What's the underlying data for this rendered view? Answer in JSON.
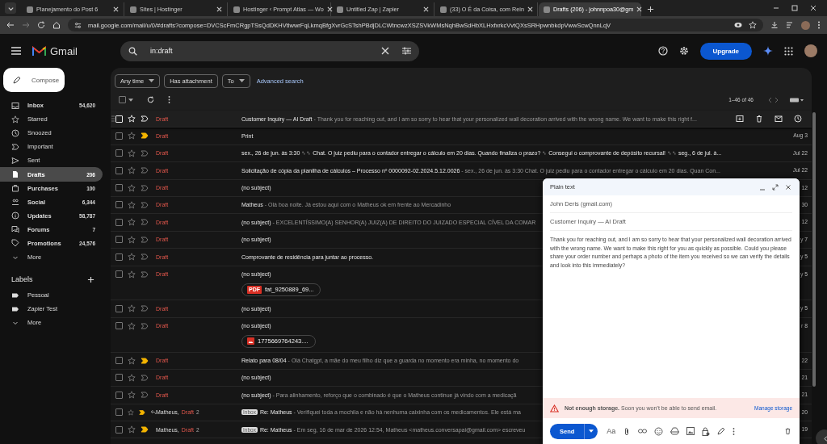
{
  "browser": {
    "tabs": [
      {
        "title": "Planejamento do Post 6",
        "selected": false
      },
      {
        "title": "Sites | Hostinger",
        "selected": false
      },
      {
        "title": "Hostinger ‹ Prompt Atlas — Wo",
        "selected": false
      },
      {
        "title": "Untitled Zap | Zapier",
        "selected": false
      },
      {
        "title": "(33) O É da Coisa, com Rein",
        "selected": false
      },
      {
        "title": "Drafts (206) - johnnpoa30@gm",
        "selected": true
      }
    ],
    "url": "mail.google.com/mail/u/0/#drafts?compose=DVCScFmCRgpTSsQdDKHVtlwwrFqLkmqBfgXvrGcSTshPBdjDLCWtncwzXSZSVkWMsNqhBwSdHbXLHxfxrkcVvtQXsSRHpwnbkdpVwwScwQnnLqV"
  },
  "app": {
    "logo": "Gmail",
    "search": "in:draft",
    "upgrade": "Upgrade"
  },
  "sidebar": {
    "compose": "Compose",
    "items": [
      {
        "label": "Inbox",
        "count": "54,620",
        "bold": true,
        "selected": false
      },
      {
        "label": "Starred",
        "bold": false,
        "selected": false
      },
      {
        "label": "Snoozed",
        "bold": false,
        "selected": false
      },
      {
        "label": "Important",
        "bold": false,
        "selected": false
      },
      {
        "label": "Sent",
        "bold": false,
        "selected": false
      },
      {
        "label": "Drafts",
        "count": "206",
        "bold": true,
        "selected": true
      },
      {
        "label": "Purchases",
        "count": "100",
        "bold": true,
        "selected": false
      },
      {
        "label": "Social",
        "count": "6,344",
        "bold": true,
        "selected": false
      },
      {
        "label": "Updates",
        "count": "58,787",
        "bold": true,
        "selected": false
      },
      {
        "label": "Forums",
        "count": "7",
        "bold": true,
        "selected": false
      },
      {
        "label": "Promotions",
        "count": "24,576",
        "bold": true,
        "selected": false
      },
      {
        "label": "More",
        "kind": "more",
        "bold": false,
        "selected": false
      }
    ],
    "labels_title": "Labels",
    "labels": [
      {
        "label": "Pessoal",
        "kind": "label"
      },
      {
        "label": "Zapier Test",
        "kind": "label"
      },
      {
        "label": "More",
        "kind": "more"
      }
    ]
  },
  "select_all": {
    "checked": false
  },
  "filters": [
    "Any time",
    "Has attachment",
    "To"
  ],
  "advanced_search": "Advanced search",
  "pagination": "1–46 of 46",
  "rows": [
    {
      "draft": "Draft",
      "subject": "Customer Inquiry — AI Draft",
      "preview": " - Thank you for reaching out, and I am so sorry to hear that your personalized wall decoration arrived with the wrong name. We want to make this right f...",
      "important": false,
      "hovered": true,
      "checked": false,
      "starred": false
    },
    {
      "draft": "Draft",
      "subject": "Print",
      "important": true,
      "hovered": false,
      "checked": false,
      "starred": false,
      "date": "Aug 3"
    },
    {
      "draft": "Draft",
      "subject": "sex., 26 de jun. às 3:30 ␞␞ Chat. O juiz pediu para o contador entregar o cálculo em 20 dias. Quando finaliza o prazo? ␞ Consegui o comprovante de depósito recursal! ␞␞ seg., 6 de jul. à...",
      "important": false,
      "hovered": false,
      "checked": false,
      "starred": false,
      "date": "Jul 22"
    },
    {
      "draft": "Draft",
      "subject": "Solicitação de cópia da planilha de cálculos – Processo nº 0000092-02.2024.5.12.0026",
      "preview": " - sex., 26 de jun. às 3:30 Chat. O juiz pediu para o contador entregar o cálculo em 20 dias. Quan Con...",
      "important": false,
      "hovered": false,
      "checked": false,
      "starred": false,
      "date": "Jul 22"
    },
    {
      "draft": "Draft",
      "subject": "(no subject)",
      "important": false,
      "hovered": false,
      "checked": false,
      "starred": false,
      "date": "12"
    },
    {
      "draft": "Draft",
      "subject": "Matheus",
      "preview": " - Olá boa noite. Já estou aqui com o Matheus ok em frente ao Mercadinho",
      "important": false,
      "hovered": false,
      "checked": false,
      "starred": false,
      "date": "30"
    },
    {
      "draft": "Draft",
      "subject": "(no subject)",
      "preview": " - EXCELENTÍSSIMO(A) SENHOR(A) JUIZ(A) DE DIREITO DO JUIZADO ESPECIAL CÍVEL DA COMAR",
      "important": false,
      "hovered": false,
      "checked": false,
      "starred": false,
      "date": "12"
    },
    {
      "draft": "Draft",
      "subject": "(no subject)",
      "important": false,
      "hovered": false,
      "checked": false,
      "starred": false,
      "date": "y 7"
    },
    {
      "draft": "Draft",
      "subject": "Comprovante de residência para juntar ao processo.",
      "important": false,
      "hovered": false,
      "checked": false,
      "starred": false,
      "date": "y 5"
    },
    {
      "draft": "Draft",
      "subject": "(no subject)",
      "attachment": {
        "name": "fat_9250889_69...",
        "kind": "pdf",
        "badge": "PDF"
      },
      "important": false,
      "hovered": false,
      "checked": false,
      "starred": false,
      "date": "y 5"
    },
    {
      "draft": "Draft",
      "subject": "(no subject)",
      "important": false,
      "hovered": false,
      "checked": false,
      "starred": false,
      "date": "y 5"
    },
    {
      "draft": "Draft",
      "subject": "(no subject)",
      "attachment": {
        "name": "1775669764243....",
        "kind": "image"
      },
      "important": false,
      "hovered": false,
      "checked": false,
      "starred": false,
      "date": "r 8"
    },
    {
      "draft": "Draft",
      "subject": "Relato para 08/04",
      "preview": " - Olá Chatgpt, a mãe do meu filho diz que a guarda no momento era minha, no momento do",
      "important": true,
      "hovered": false,
      "checked": false,
      "starred": false,
      "date": "22"
    },
    {
      "draft": "Draft",
      "subject": "(no subject)",
      "important": false,
      "hovered": false,
      "checked": false,
      "starred": false,
      "date": "21"
    },
    {
      "draft": "Draft",
      "subject": "(no subject)",
      "preview": " - Para alinhamento, reforço que o combinado é que o Matheus continue já vindo com a medicaçã",
      "important": false,
      "hovered": false,
      "checked": false,
      "starred": false,
      "date": "21"
    },
    {
      "name": "Matheus,",
      "draft": "Draft",
      "count": "2",
      "replied": true,
      "tag": "Inbox",
      "subject": "Re: Matheus",
      "preview": " - Verifiquei toda a mochila e não há nenhuma caixinha com os medicamentos. Ele está ma",
      "important": true,
      "hovered": false,
      "checked": false,
      "starred": false,
      "date": "20"
    },
    {
      "name": "Matheus,",
      "draft": "Draft",
      "count": "2",
      "replied": false,
      "tag": "Inbox",
      "subject": "Re: Matheus",
      "preview": " - Em seg, 16 de mar de 2026 12:54, Matheus <matheus.conversapai@gmail.com> escreveu",
      "important": true,
      "hovered": false,
      "checked": false,
      "starred": false,
      "date": "19"
    }
  ],
  "compose": {
    "title": "Plain text",
    "to": "John Deris (gmail.com)",
    "subject": "Customer Inquiry — AI Draft",
    "body": "Thank you for reaching out, and I am so sorry to hear that your personalized wall decoration arrived with the wrong name. We want to make this right for you as quickly as possible. Could you please share your order number and perhaps a photo of the item you received so we can verify the details and look into this immediately?",
    "warning": "**Not enough storage.** Soon you won’t be able to send email.",
    "warning_link": "Manage storage",
    "send": "Send",
    "format": "Aa"
  }
}
